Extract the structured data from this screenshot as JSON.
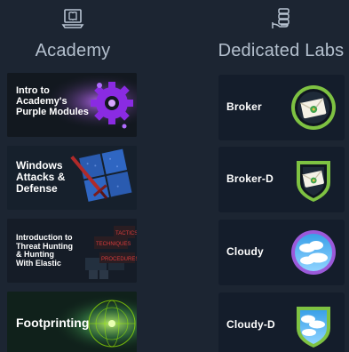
{
  "academy": {
    "heading": "Academy",
    "heading_icon": "laptop-book-icon",
    "cards": [
      {
        "title": "Intro to\nAcademy's\nPurple Modules",
        "art": "purple-gear-art",
        "accent": "#9b3bff"
      },
      {
        "title": "Windows\nAttacks &\nDefense",
        "art": "sword-shield-art",
        "accent": "#c4302b"
      },
      {
        "title": "Introduction to\nThreat Hunting\n& Hunting\nWith Elastic",
        "art": "tactics-boards-art",
        "accent": "#d63b3b"
      },
      {
        "title": "Footprinting",
        "art": "radar-globe-art",
        "accent": "#9fef00"
      }
    ]
  },
  "labs": {
    "heading": "Dedicated Labs",
    "heading_icon": "server-hand-icon",
    "cards": [
      {
        "name": "Broker",
        "badge": "envelope-circle-badge",
        "ring": "#7ec242",
        "shape": "circle"
      },
      {
        "name": "Broker-D",
        "badge": "envelope-shield-badge",
        "ring": "#7ec242",
        "shape": "shield"
      },
      {
        "name": "Cloudy",
        "badge": "clouds-circle-badge",
        "ring": "#9b59d9",
        "shape": "circle"
      },
      {
        "name": "Cloudy-D",
        "badge": "clouds-shield-badge",
        "ring": "#7ec242",
        "shape": "shield"
      }
    ]
  },
  "colors": {
    "background": "#1c2532",
    "card": "#141d2b",
    "heading": "#b4c0ce",
    "lime": "#9fef00"
  }
}
